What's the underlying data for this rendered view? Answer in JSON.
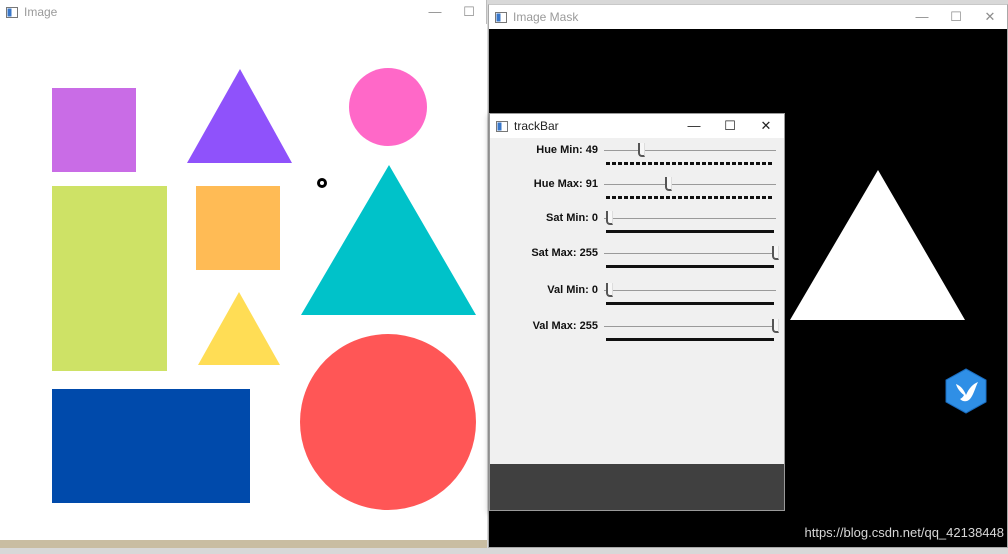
{
  "windows": {
    "image": {
      "title": "Image",
      "controls": {
        "minimize": "—",
        "maximize": "☐"
      }
    },
    "mask": {
      "title": "Image Mask",
      "controls": {
        "minimize": "—",
        "maximize": "☐",
        "close": "✕"
      }
    },
    "trackbar": {
      "title": "trackBar",
      "controls": {
        "minimize": "—",
        "maximize": "☐",
        "close": "✕"
      }
    }
  },
  "trackbars": [
    {
      "label": "Hue Min: 49",
      "value": 49,
      "max": 255,
      "dashed": true
    },
    {
      "label": "Hue Max: 91",
      "value": 91,
      "max": 255,
      "dashed": true
    },
    {
      "label": "Sat Min: 0",
      "value": 0,
      "max": 255,
      "dashed": false
    },
    {
      "label": "Sat Max: 255",
      "value": 255,
      "max": 255,
      "dashed": false
    },
    {
      "label": "Val Min: 0",
      "value": 0,
      "max": 255,
      "dashed": false
    },
    {
      "label": "Val Max: 255",
      "value": 255,
      "max": 255,
      "dashed": false
    }
  ],
  "shape_colors": {
    "violet_square": "#c96ce6",
    "purple_triangle": "#8f52fb",
    "pink_circle": "#ff68c8",
    "lime_rect": "#cee266",
    "orange_square": "#ffbb55",
    "teal_triangle": "#00c2c9",
    "yellow_triangle": "#ffdd55",
    "blue_rect": "#004aab",
    "red_circle": "#ff5656",
    "mask_white": "#ffffff"
  },
  "watermark": "https://blog.csdn.net/qq_42138448"
}
